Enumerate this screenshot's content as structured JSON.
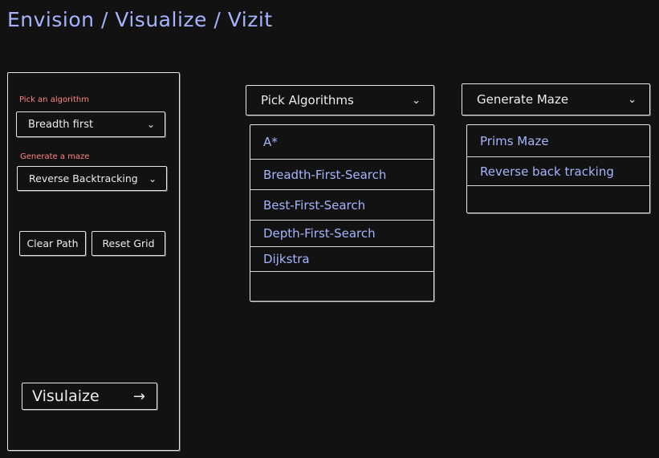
{
  "header": {
    "title": "Envision / Visualize / Vizit"
  },
  "sidebar": {
    "algorithm_label": "Pick an algorithm",
    "algorithm_value": "Breadth first",
    "maze_label": "Generate a maze",
    "maze_value": "Reverse Backtracking",
    "clear_path": "Clear Path",
    "reset_grid": "Reset Grid",
    "visualize": "Visulaize",
    "arrow": "→"
  },
  "algorithms_dropdown": {
    "header": "Pick Algorithms",
    "items": [
      "A*",
      "Breadth-First-Search",
      "Best-First-Search",
      "Depth-First-Search",
      "Dijkstra"
    ]
  },
  "maze_dropdown": {
    "header": "Generate Maze",
    "items": [
      "Prims Maze",
      "Reverse back tracking"
    ]
  },
  "chevron": "⌄",
  "colors": {
    "background": "#121212",
    "accent": "#a5b4fc",
    "label_red": "#ff8383",
    "stroke": "#e6e6e6"
  },
  "icons": [
    "chevron-down-icon",
    "arrow-right-icon"
  ]
}
